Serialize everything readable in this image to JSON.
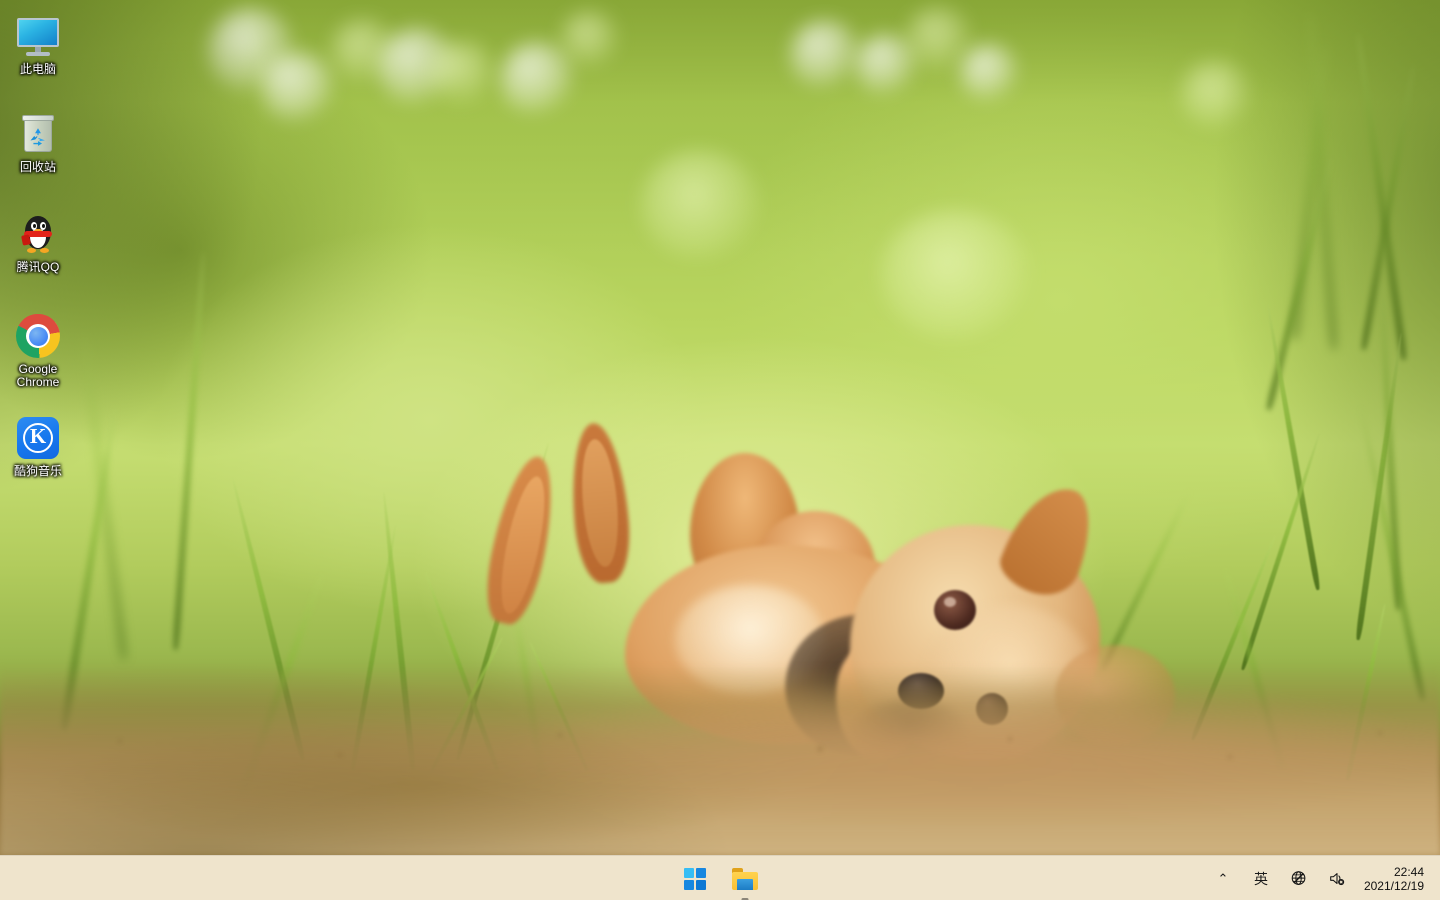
{
  "desktop": {
    "wallpaper_description": "Blurred green grass bokeh with a Yorkshire terrier puppy lying on its side on a dirt path",
    "icons": [
      {
        "label": "此电脑",
        "icon": "monitor-icon",
        "name": "desktop-icon-this-pc"
      },
      {
        "label": "回收站",
        "icon": "recycle-bin-icon",
        "name": "desktop-icon-recycle-bin"
      },
      {
        "label": "腾讯QQ",
        "icon": "qq-penguin-icon",
        "name": "desktop-icon-tencent-qq"
      },
      {
        "label": "Google Chrome",
        "icon": "chrome-icon",
        "name": "desktop-icon-google-chrome"
      },
      {
        "label": "酷狗音乐",
        "icon": "kugou-music-icon",
        "name": "desktop-icon-kugou-music"
      }
    ]
  },
  "taskbar": {
    "background_color": "#efe4cc",
    "buttons": [
      {
        "label": "开始",
        "icon": "windows-logo-icon",
        "name": "start-button",
        "running": false
      },
      {
        "label": "文件资源管理器",
        "icon": "file-explorer-icon",
        "name": "file-explorer-button",
        "running": true
      }
    ],
    "tray": {
      "overflow_chevron": "⌃",
      "ime_indicator": "英",
      "network_icon": "globe-disconnected-icon",
      "volume_icon": "speaker-muted-icon"
    },
    "clock": {
      "time": "22:44",
      "date": "2021/12/19"
    }
  },
  "colors": {
    "accent_blue": "#1677ee",
    "taskbar": "#efe4cc",
    "icon_label_text": "#ffffff",
    "tray_text": "#101010"
  }
}
